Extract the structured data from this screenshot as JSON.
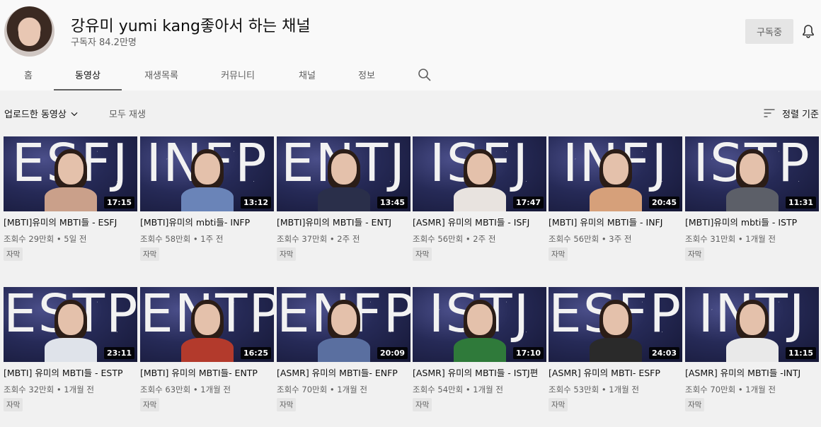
{
  "channel": {
    "name": "강유미 yumi kang좋아서 하는 채널",
    "subscribers": "구독자 84.2만명",
    "subscribe_label": "구독중"
  },
  "tabs": [
    {
      "label": "홈"
    },
    {
      "label": "동영상",
      "active": true
    },
    {
      "label": "재생목록"
    },
    {
      "label": "커뮤니티"
    },
    {
      "label": "채널"
    },
    {
      "label": "정보"
    }
  ],
  "filter": {
    "uploads_label": "업로드한 동영상",
    "play_all_label": "모두 재생",
    "sort_label": "정렬 기준"
  },
  "icons": {
    "bell": "bell-icon",
    "search": "search-icon",
    "sort": "sort-icon",
    "dropdown": "chevron-down-icon"
  },
  "colors": {
    "background": "#f9f9f9",
    "content_background": "#f1f1f1",
    "text_primary": "#0f0f0f",
    "text_secondary": "#606060"
  },
  "videos": [
    {
      "thumb_text": "ESFJ",
      "duration": "17:15",
      "title": "[MBTI]유미의 MBTI들 - ESFJ",
      "meta": "조회수 29만회 • 5일 전",
      "badge": "자막",
      "shirt": "#caa08a"
    },
    {
      "thumb_text": "INFP",
      "duration": "13:12",
      "title": "[MBTI]유미의 mbti들- INFP",
      "meta": "조회수 58만회 • 1주 전",
      "badge": "자막",
      "shirt": "#6a84b8"
    },
    {
      "thumb_text": "ENTJ",
      "duration": "13:45",
      "title": "[MBTI]유미의 MBTI들 - ENTJ",
      "meta": "조회수 37만회 • 2주 전",
      "badge": "자막",
      "shirt": "#2a2f4a"
    },
    {
      "thumb_text": "ISFJ",
      "duration": "17:47",
      "title": "[ASMR] 유미의 MBTI들 - ISFJ",
      "meta": "조회수 56만회 • 2주 전",
      "badge": "자막",
      "shirt": "#e8e3df"
    },
    {
      "thumb_text": "INFJ",
      "duration": "20:45",
      "title": "[MBTI] 유미의 MBTI들 - INFJ",
      "meta": "조회수 56만회 • 3주 전",
      "badge": "자막",
      "shirt": "#d6a07a"
    },
    {
      "thumb_text": "ISTP",
      "duration": "11:31",
      "title": "[MBTI]유미의 mbti들 - ISTP",
      "meta": "조회수 31만회 • 1개월 전",
      "badge": "자막",
      "shirt": "#5c5f68"
    },
    {
      "thumb_text": "ESTP",
      "duration": "23:11",
      "title": "[MBTI] 유미의 MBTI들 - ESTP",
      "meta": "조회수 32만회 • 1개월 전",
      "badge": "자막",
      "shirt": "#dfe3ea"
    },
    {
      "thumb_text": "ENTP",
      "duration": "16:25",
      "title": "[MBTI] 유미의 MBTI들- ENTP",
      "meta": "조회수 63만회 • 1개월 전",
      "badge": "자막",
      "shirt": "#b33a2c"
    },
    {
      "thumb_text": "ENFP",
      "duration": "20:09",
      "title": "[ASMR] 유미의 MBTI들- ENFP",
      "meta": "조회수 70만회 • 1개월 전",
      "badge": "자막",
      "shirt": "#5a6fa0"
    },
    {
      "thumb_text": "ISTJ",
      "duration": "17:10",
      "title": "[ASMR] 유미의 MBTI들 - ISTJ편",
      "meta": "조회수 54만회 • 1개월 전",
      "badge": "자막",
      "shirt": "#2f7a3a"
    },
    {
      "thumb_text": "ESFP",
      "duration": "24:03",
      "title": "[ASMR] 유미의 MBTI- ESFP",
      "meta": "조회수 53만회 • 1개월 전",
      "badge": "자막",
      "shirt": "#2a2a2a"
    },
    {
      "thumb_text": "INTJ",
      "duration": "11:15",
      "title": "[ASMR] 유미의 MBTI들 -INTJ",
      "meta": "조회수 70만회 • 1개월 전",
      "badge": "자막",
      "shirt": "#e9e9e9"
    }
  ]
}
